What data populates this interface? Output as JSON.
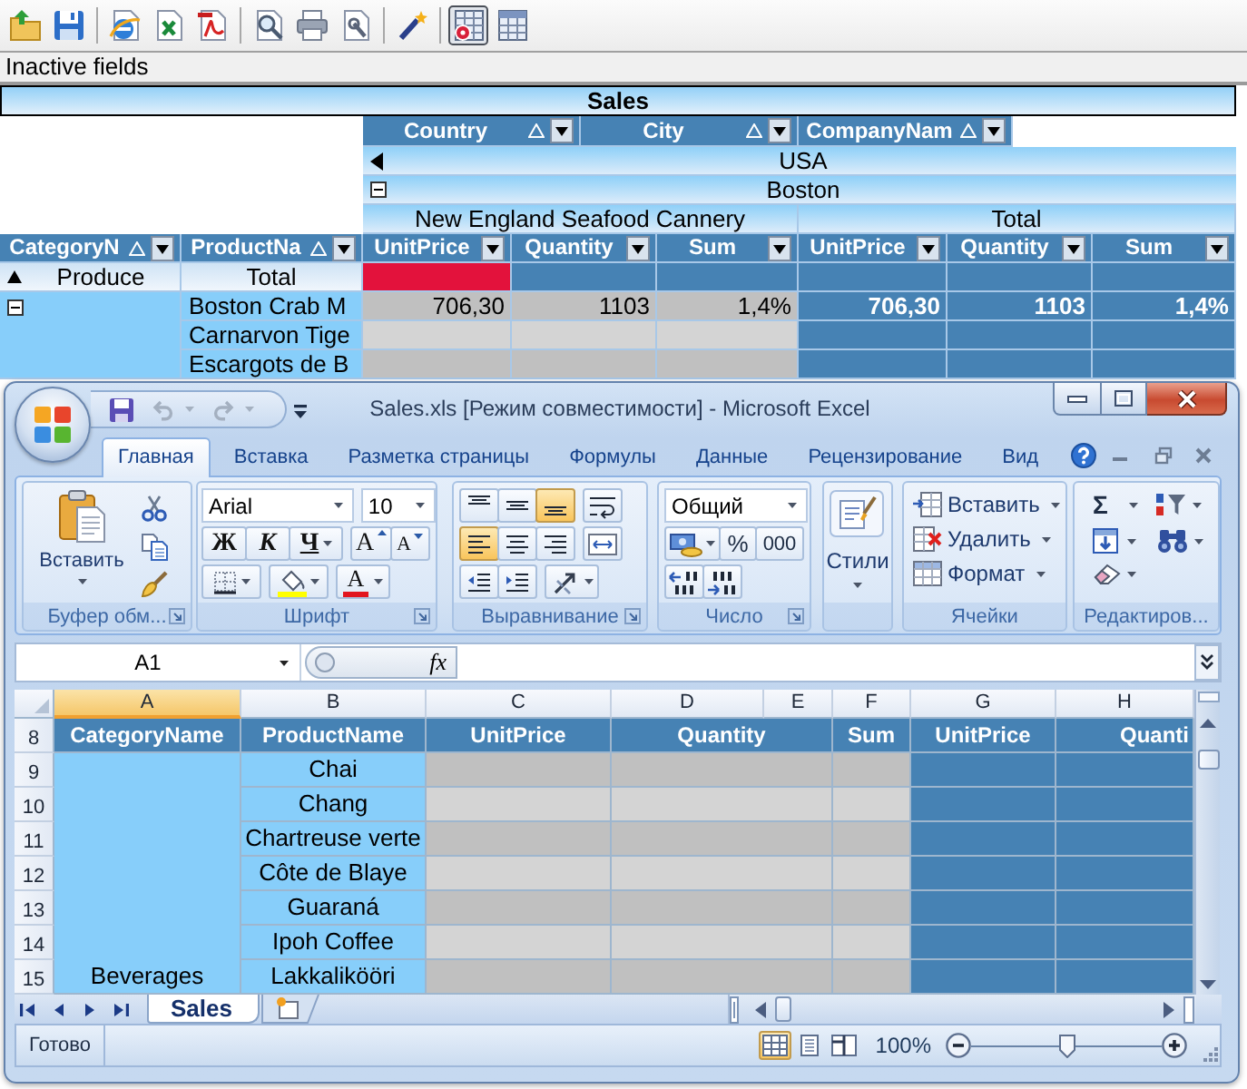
{
  "toolbar": {
    "groups": [
      [
        {
          "kind": "open",
          "pressed": false
        },
        {
          "kind": "save",
          "pressed": false
        }
      ],
      [
        {
          "kind": "web",
          "pressed": false
        },
        {
          "kind": "excel",
          "pressed": false
        },
        {
          "kind": "pdf",
          "pressed": false
        }
      ],
      [
        {
          "kind": "preview",
          "pressed": false
        },
        {
          "kind": "print",
          "pressed": false
        },
        {
          "kind": "setup",
          "pressed": false
        }
      ],
      [
        {
          "kind": "wizard",
          "pressed": false
        }
      ],
      [
        {
          "kind": "layout",
          "pressed": true
        },
        {
          "kind": "grid",
          "pressed": false
        }
      ]
    ]
  },
  "inactive_fields": {
    "label": "Inactive fields"
  },
  "pivot": {
    "title": "Sales",
    "column_fields": [
      "Country",
      "City",
      "CompanyNam"
    ],
    "column_levels": [
      {
        "label": "USA",
        "kind": "arrow"
      },
      {
        "label": "Boston",
        "kind": "minus"
      }
    ],
    "companies": [
      "New England Seafood Cannery",
      "Total"
    ],
    "row_fields": [
      "CategoryN",
      "ProductNa"
    ],
    "measures": [
      "UnitPrice",
      "Quantity",
      "Sum",
      "UnitPrice",
      "Quantity",
      "Sum"
    ],
    "row_groups": [
      {
        "category": "Produce",
        "expanded": false,
        "rows": [
          {
            "kind": "total",
            "product": "Total",
            "cells": [
              {
                "highlighted": true
              },
              {
                "highlighted": false
              },
              {
                "highlighted": false
              },
              {
                "highlighted": false
              },
              {
                "highlighted": false
              },
              {
                "highlighted": false
              }
            ]
          }
        ]
      },
      {
        "expanded": true,
        "rows": [
          {
            "kind": "item",
            "product": "Boston Crab M",
            "cells": [
              {
                "value": "706,30",
                "highlighted": false
              },
              {
                "value": "1103",
                "highlighted": false
              },
              {
                "value": "1,4%",
                "highlighted": false
              },
              {
                "value": "706,30",
                "highlighted": false
              },
              {
                "value": "1103",
                "highlighted": false
              },
              {
                "value": "1,4%",
                "highlighted": false
              }
            ]
          },
          {
            "kind": "item",
            "product": "Carnarvon Tige",
            "cells": [
              {
                "highlighted": false
              },
              {
                "highlighted": false
              },
              {
                "highlighted": false
              },
              {
                "highlighted": false
              },
              {
                "highlighted": false
              },
              {
                "highlighted": false
              }
            ]
          },
          {
            "kind": "item",
            "product": "Escargots de B",
            "cells": [
              {
                "highlighted": false
              },
              {
                "highlighted": false
              },
              {
                "highlighted": false
              },
              {
                "highlighted": false
              },
              {
                "highlighted": false
              },
              {
                "highlighted": false
              }
            ]
          }
        ]
      }
    ]
  },
  "excel": {
    "title": "Sales.xls [Режим совместимости] - Microsoft Excel",
    "quick_access": [
      {
        "kind": "save",
        "disabled": false
      },
      {
        "kind": "undo",
        "disabled": true
      },
      {
        "kind": "redo",
        "disabled": true
      }
    ],
    "tabs": [
      {
        "label": "Главная",
        "selected": true
      },
      {
        "label": "Вставка",
        "selected": false
      },
      {
        "label": "Разметка страницы",
        "selected": false
      },
      {
        "label": "Формулы",
        "selected": false
      },
      {
        "label": "Данные",
        "selected": false
      },
      {
        "label": "Рецензирование",
        "selected": false
      },
      {
        "label": "Вид",
        "selected": false
      }
    ],
    "groups": [
      {
        "kind": "clipboard",
        "label": "Буфер обм...",
        "button": "Вставить"
      },
      {
        "kind": "font",
        "label": "Шрифт",
        "font": "Arial",
        "size": "10",
        "styles": [
          "Ж",
          "К",
          "Ч"
        ],
        "grow": "A",
        "shrink": "A",
        "color_letter": "A"
      },
      {
        "kind": "alignment",
        "label": "Выравнивание",
        "vertical": [
          {
            "kind": "top",
            "selected": false
          },
          {
            "kind": "middle",
            "selected": false
          },
          {
            "kind": "bottom",
            "selected": true
          }
        ],
        "horizontal": [
          {
            "kind": "left",
            "selected": true
          },
          {
            "kind": "center",
            "selected": false
          },
          {
            "kind": "right",
            "selected": false
          }
        ]
      },
      {
        "kind": "number",
        "label": "Число",
        "format": "Общий",
        "percent": "%",
        "thousands": "000"
      },
      {
        "kind": "styles",
        "button": "Стили"
      },
      {
        "kind": "cells",
        "label": "Ячейки",
        "buttons": [
          {
            "kind": "insert",
            "label": "Вставить"
          },
          {
            "kind": "delete",
            "label": "Удалить"
          },
          {
            "kind": "format",
            "label": "Формат"
          }
        ]
      },
      {
        "kind": "editing",
        "label": "Редактиров...",
        "sum": "Σ"
      }
    ],
    "name_box": "A1",
    "function_label": "fx",
    "columns": [
      {
        "label": "A",
        "selected": true
      },
      {
        "label": "B",
        "selected": false
      },
      {
        "label": "C",
        "selected": false
      },
      {
        "label": "D",
        "selected": false
      },
      {
        "label": "E",
        "selected": false
      },
      {
        "label": "F",
        "selected": false
      },
      {
        "label": "G",
        "selected": false
      },
      {
        "label": "H",
        "selected": false
      }
    ],
    "row_numbers": [
      "8",
      "9",
      "10",
      "11",
      "12",
      "13",
      "14",
      "15"
    ],
    "header_cells": [
      "CategoryName",
      "ProductName",
      "UnitPrice",
      "Quantity",
      "Sum",
      "UnitPrice",
      "Quanti"
    ],
    "category": "Beverages",
    "products": [
      "Chai",
      "Chang",
      "Chartreuse verte",
      "Côte de Blaye",
      "Guaraná",
      "Ipoh Coffee",
      "Lakkalikööri"
    ],
    "sheet_tabs": [
      {
        "label": "Sales",
        "selected": true
      }
    ],
    "status": "Готово",
    "views": [
      {
        "kind": "normal",
        "selected": true
      },
      {
        "kind": "layout",
        "selected": false
      },
      {
        "kind": "break",
        "selected": false
      }
    ],
    "zoom": {
      "label": "100%",
      "level": 0.5
    }
  }
}
